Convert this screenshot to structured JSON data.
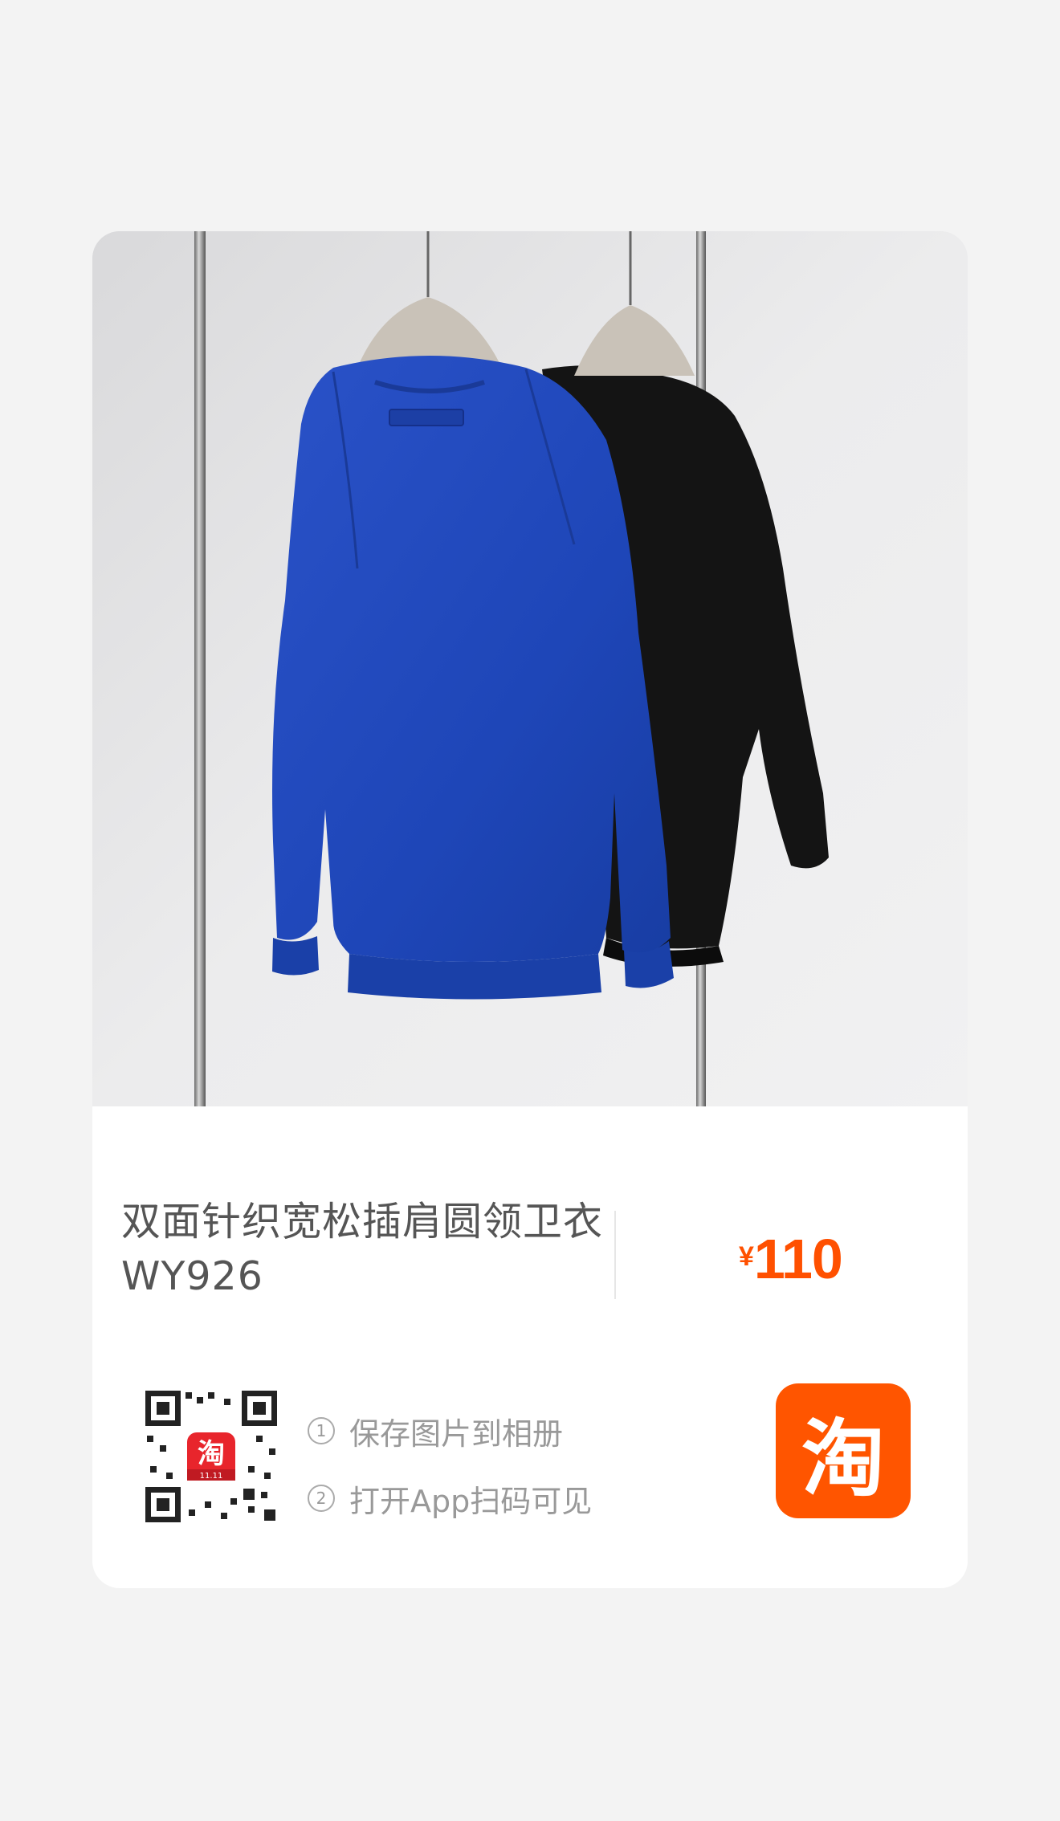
{
  "product": {
    "title_line1": "双面针织宽松插肩圆领卫衣",
    "title_line2": "WY926",
    "price_currency": "¥",
    "price_value": "110"
  },
  "qr": {
    "badge_char": "淘",
    "badge_sub": "11.11"
  },
  "steps": [
    {
      "num": "1",
      "text": "保存图片到相册"
    },
    {
      "num": "2",
      "text": "打开App扫码可见"
    }
  ],
  "app_logo": {
    "char": "淘",
    "color": "#ff5500"
  },
  "colors": {
    "price": "#ff5000",
    "background": "#f3f3f3",
    "card": "#ffffff"
  }
}
